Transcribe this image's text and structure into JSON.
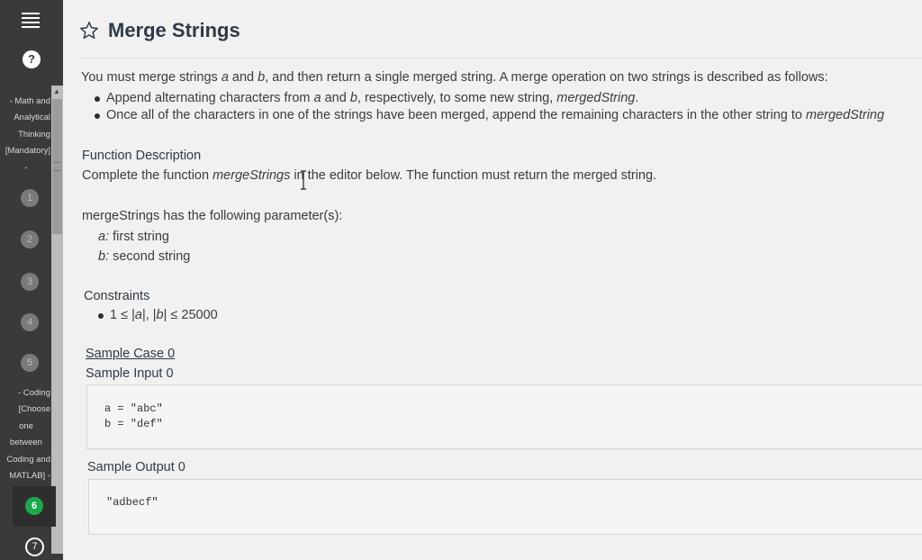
{
  "sidebar": {
    "help_glyph": "?",
    "section1": {
      "lines": [
        "- Math and",
        "Analytical",
        "Thinking",
        "[Mandatory]",
        "-"
      ]
    },
    "section2": {
      "lines": [
        "- Coding",
        "[Choose",
        "one",
        "between",
        "Coding and",
        "MATLAB] -"
      ]
    },
    "questions": [
      "1",
      "2",
      "3",
      "4",
      "5",
      "6",
      "7"
    ],
    "active_question": "6",
    "active_color": "#1ba94c"
  },
  "problem": {
    "title": "Merge Strings",
    "intro": {
      "p1": "You must merge strings ",
      "a": "a",
      "p2": " and ",
      "b": "b",
      "p3": ", and then return a single merged string. A merge operation on two strings is described as follows:"
    },
    "bullet1": {
      "p1": "Append alternating characters from ",
      "a": "a",
      "p2": " and ",
      "b": "b",
      "p3": ", respectively, to some new string, ",
      "name": "mergedString",
      "p4": "."
    },
    "bullet2": {
      "p1": "Once all of the characters in one of the strings have been merged, append the remaining characters in the other string to ",
      "name": "mergedString"
    },
    "function_description": {
      "heading": "Function Description",
      "p1": "Complete the function ",
      "name": "mergeStrings",
      "p2": " in the editor below. The function must return the merged string."
    },
    "parameters": {
      "intro": "mergeStrings has the following parameter(s):",
      "a_name": "a:",
      "a_desc": " first string",
      "b_name": "b:",
      "b_desc": " second string"
    },
    "constraints": {
      "heading": "Constraints",
      "p1": "1 ≤ |",
      "a": "a",
      "p2": "|, |",
      "b": "b",
      "p3": "| ≤ 25000"
    },
    "sample": {
      "case_heading": "Sample Case 0",
      "input_heading": "Sample Input 0",
      "input_lines": [
        "a = \"abc\"",
        "b = \"def\""
      ],
      "output_heading": "Sample Output 0",
      "output_lines": [
        "\"adbecf\""
      ]
    }
  }
}
